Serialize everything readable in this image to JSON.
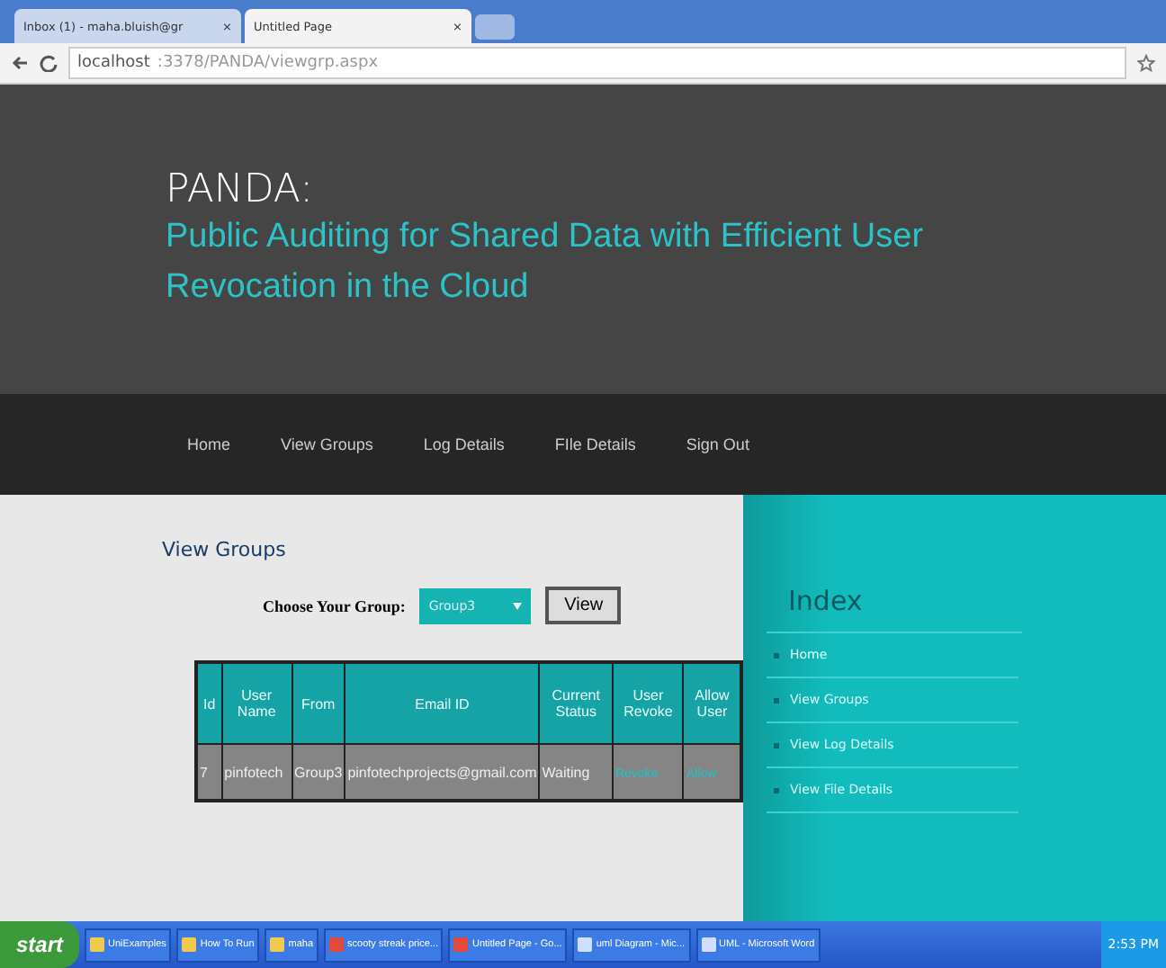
{
  "browser": {
    "tabs": [
      {
        "label": "Inbox (1) - maha.bluish@gr",
        "close": "×",
        "selected": false
      },
      {
        "label": "Untitled Page",
        "close": "×",
        "selected": true
      }
    ],
    "url_host": "localhost",
    "url_path": ":3378/PANDA/viewgrp.aspx"
  },
  "header": {
    "title": "PANDA:",
    "subtitle": "Public Auditing for Shared Data with Efficient User Revocation in the Cloud"
  },
  "nav": [
    "Home",
    "View Groups",
    "Log Details",
    "FIle Details",
    "Sign Out"
  ],
  "main": {
    "heading": "View Groups",
    "choose_label": "Choose Your Group:",
    "group_select": "Group3",
    "view_button": "View",
    "table": {
      "columns": [
        "Id",
        "User Name",
        "From",
        "Email ID",
        "Current Status",
        "User Revoke",
        "Allow User"
      ],
      "rows": [
        [
          "7",
          "pinfotech",
          "Group3",
          "pinfotechprojects@gmail.com",
          "Waiting",
          "Revoke",
          "Allow"
        ]
      ]
    }
  },
  "sidebar": {
    "title": "Index",
    "items": [
      "Home",
      "View Groups",
      "View Log Details",
      "View File Details"
    ]
  },
  "taskbar": {
    "start": "start",
    "items": [
      {
        "label": "UniExamples",
        "kind": "folder"
      },
      {
        "label": "How To Run",
        "kind": "folder"
      },
      {
        "label": "maha",
        "kind": "folder"
      },
      {
        "label": "scooty streak price...",
        "kind": "browser"
      },
      {
        "label": "Untitled Page - Go...",
        "kind": "browser"
      },
      {
        "label": "uml Diagram - Mic...",
        "kind": "doc"
      },
      {
        "label": "UML - Microsoft Word",
        "kind": "doc"
      }
    ],
    "clock": "2:53 PM"
  }
}
